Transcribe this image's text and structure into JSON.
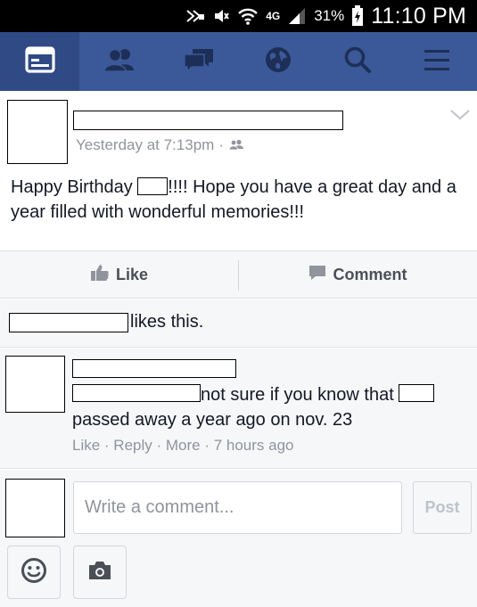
{
  "status_bar": {
    "network": "4G",
    "battery_percent": "31%",
    "time": "11:10 PM"
  },
  "nav": {
    "tabs": [
      {
        "name": "news-feed",
        "icon": "news-feed-icon",
        "active": true
      },
      {
        "name": "friend-requests",
        "icon": "friends-icon"
      },
      {
        "name": "messages",
        "icon": "messages-icon"
      },
      {
        "name": "notifications",
        "icon": "globe-icon"
      },
      {
        "name": "search",
        "icon": "search-icon"
      },
      {
        "name": "menu",
        "icon": "hamburger-menu-icon"
      }
    ]
  },
  "post": {
    "timestamp": "Yesterday at 7:13pm",
    "separator": "·",
    "privacy_icon": "friends-audience-icon",
    "text_before": "Happy Birthday ",
    "text_after": "!!!! Hope you have a great day and a year filled with wonderful memories!!!",
    "like_label": "Like",
    "comment_label": "Comment",
    "likes_suffix": "likes this."
  },
  "comment": {
    "text_part1": "not sure if you know that ",
    "text_part2": " passed away a year ago on nov. 23",
    "actions": {
      "like": "Like",
      "reply": "Reply",
      "more": "More",
      "time": "7 hours ago",
      "separator": " · "
    }
  },
  "composer": {
    "placeholder": "Write a comment...",
    "post_label": "Post",
    "emoji_icon": "smiley-icon",
    "camera_icon": "camera-icon"
  },
  "colors": {
    "nav_bg": "#3b5998",
    "nav_active": "#2f4a85",
    "secondary_text": "#90949c",
    "action_text": "#4b4f56"
  }
}
